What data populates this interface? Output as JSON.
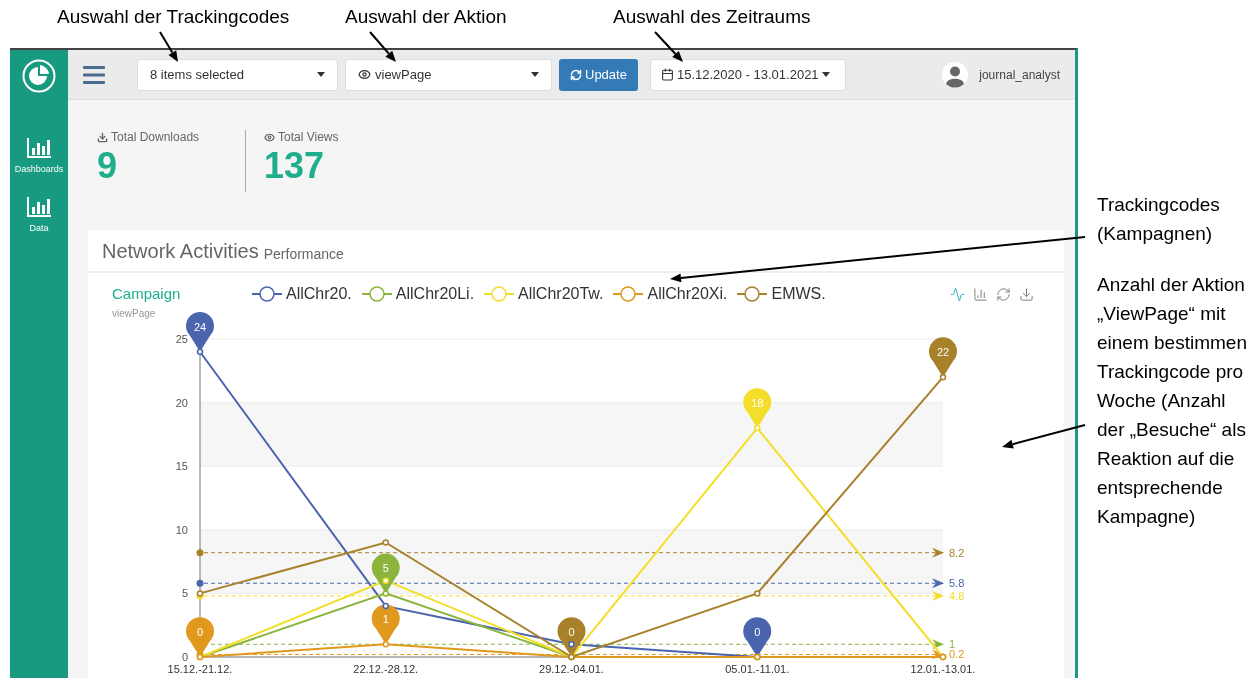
{
  "annotations": {
    "top": [
      {
        "text": "Auswahl der Trackingcodes"
      },
      {
        "text": "Auswahl der Aktion"
      },
      {
        "text": "Auswahl des Zeitraums"
      }
    ],
    "side": [
      {
        "text": "Trackingcodes (Kampagnen)"
      },
      {
        "text": "Anzahl der Aktion „ViewPage“ mit einem bestimmen Trackingcode pro Woche (Anzahl der „Besuche“ als Reaktion auf die entsprechende Kampagne)"
      }
    ]
  },
  "sidebar": {
    "items": [
      {
        "label": "Dashboards"
      },
      {
        "label": "Data"
      }
    ]
  },
  "topbar": {
    "tracking_select": {
      "value": "8 items selected"
    },
    "action_select": {
      "value": "viewPage"
    },
    "update_button": "Update",
    "date_range": "15.12.2020 - 13.01.2021",
    "user": "journal_analyst"
  },
  "stats": [
    {
      "kind": "downloads",
      "label": "Total Downloads",
      "value": "9"
    },
    {
      "kind": "views",
      "label": "Total Views",
      "value": "137"
    }
  ],
  "panel": {
    "title": "Network Activities",
    "subtitle": "Performance",
    "chart_title": "Campaign",
    "chart_subtitle": "viewPage",
    "toolbox": [
      {
        "kind": "line",
        "selected": true
      },
      {
        "kind": "bar",
        "selected": false
      },
      {
        "kind": "restore",
        "selected": false
      },
      {
        "kind": "save",
        "selected": false
      }
    ],
    "chart_data": {
      "type": "line",
      "categories": [
        "15.12.-21.12.",
        "22.12.-28.12.",
        "29.12.-04.01.",
        "05.01.-11.01.",
        "12.01.-13.01."
      ],
      "ylim": [
        0,
        25
      ],
      "yticks": [
        0,
        5,
        10,
        15,
        20,
        25
      ],
      "series": [
        {
          "name": "AllChr20.",
          "color": "#4a64ad",
          "marker": "circle",
          "values": [
            24,
            4,
            1,
            0,
            0
          ]
        },
        {
          "name": "AllChr20Li.",
          "color": "#8ab43c",
          "marker": "circle",
          "values": [
            0,
            5,
            0,
            0,
            0
          ]
        },
        {
          "name": "AllChr20Tw.",
          "color": "#f3df2b",
          "marker": "circle",
          "values": [
            0,
            6,
            0,
            18,
            0
          ]
        },
        {
          "name": "AllChr20Xi.",
          "color": "#e0991c",
          "marker": "circle",
          "values": [
            0,
            1,
            0,
            0,
            0
          ]
        },
        {
          "name": "EMWS.",
          "color": "#a8812b",
          "marker": "circle",
          "values": [
            5,
            9,
            0,
            5,
            22
          ]
        }
      ],
      "grid": true,
      "ref_lines": [
        {
          "axis": "y",
          "value": 8.2,
          "label": "8.2",
          "color": "#a8812b"
        },
        {
          "axis": "y",
          "value": 5.8,
          "label": "5.8",
          "color": "#4a64ad"
        },
        {
          "axis": "y",
          "value": 4.8,
          "label": "4.8",
          "color": "#f3df2b"
        },
        {
          "axis": "y",
          "value": 1,
          "label": "1",
          "color": "#8ab43c"
        },
        {
          "axis": "y",
          "value": 0.2,
          "label": "0.2",
          "color": "#e0991c"
        }
      ],
      "annotations": [
        {
          "text": "24",
          "x": "15.12.-21.12.",
          "y": 24
        },
        {
          "text": "22",
          "x": "12.01.-13.01.",
          "y": 22
        },
        {
          "text": "18",
          "x": "05.01.-11.01.",
          "y": 18
        },
        {
          "text": "5",
          "x": "22.12.-28.12.",
          "y": 5
        },
        {
          "text": "1",
          "x": "22.12.-28.12.",
          "y": 1
        },
        {
          "text": "0",
          "x": "15.12.-21.12.",
          "y": 0
        },
        {
          "text": "0",
          "x": "29.12.-04.01.",
          "y": 0
        },
        {
          "text": "0",
          "x": "05.01.-11.01.",
          "y": 0
        }
      ]
    },
    "pins": [
      {
        "color": "#4a64ad"
      },
      {
        "color": "#a8812b"
      },
      {
        "color": "#f3df2b"
      },
      {
        "color": "#8ab43c"
      },
      {
        "color": "#e0991c"
      },
      {
        "color": "#e0991c"
      },
      {
        "color": "#a8812b"
      },
      {
        "color": "#4a64ad"
      }
    ]
  }
}
